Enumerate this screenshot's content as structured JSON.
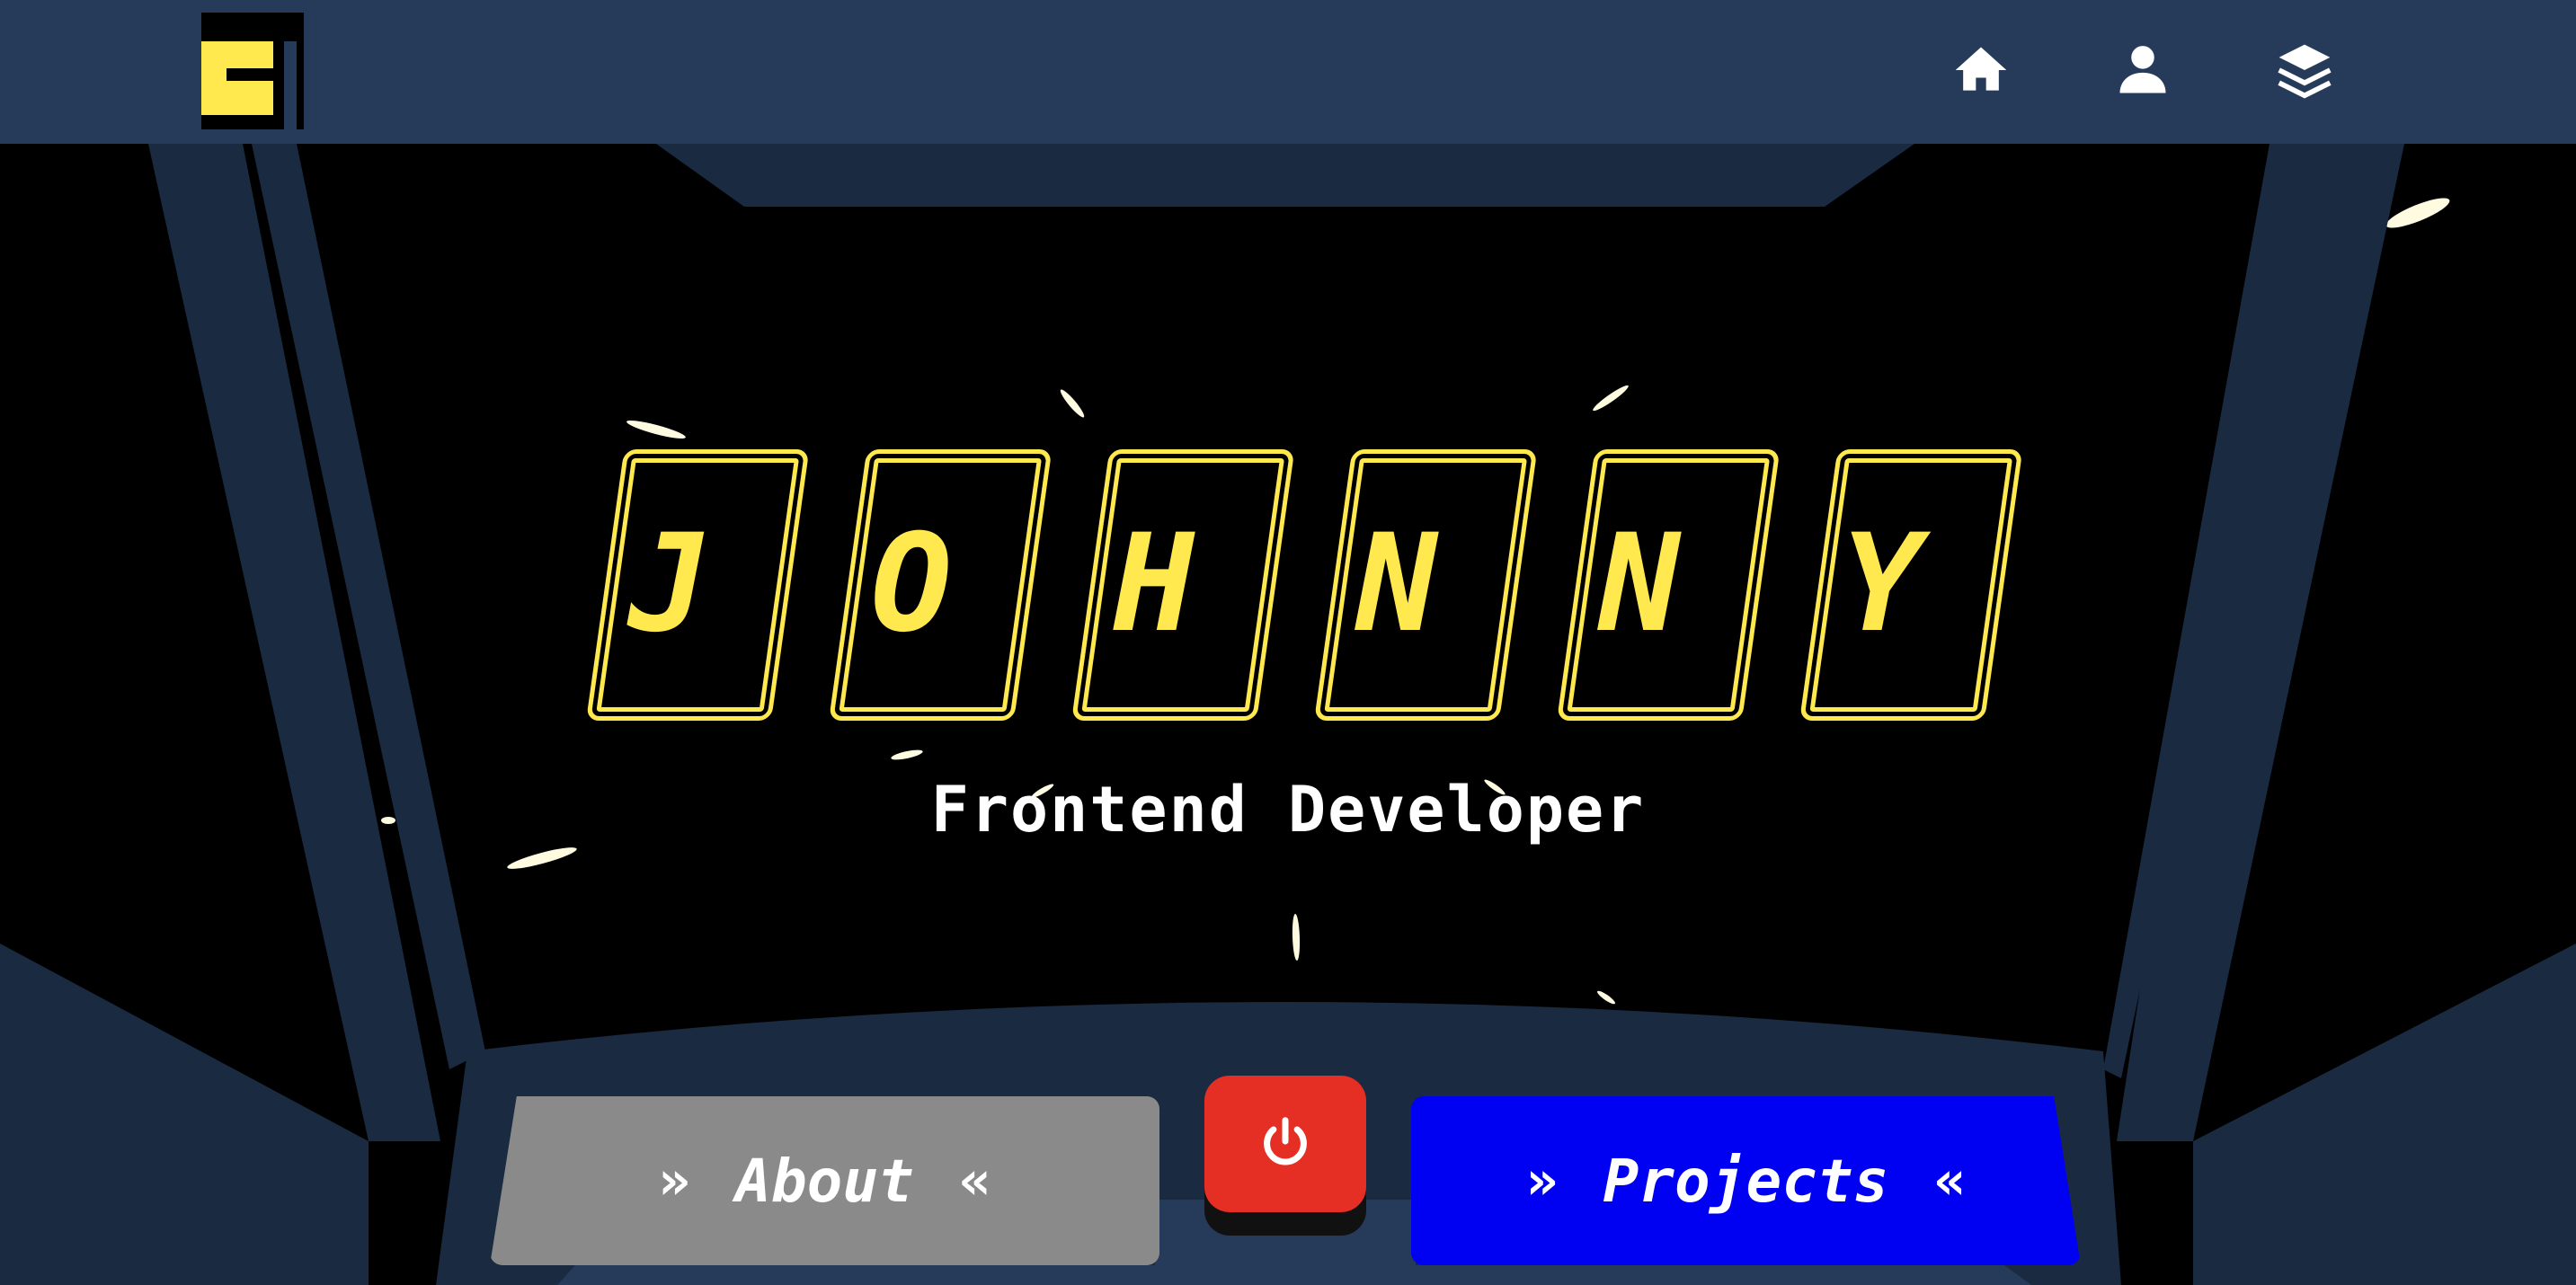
{
  "header": {
    "logo": "EI-logo",
    "nav": [
      {
        "icon": "home-icon"
      },
      {
        "icon": "user-icon"
      },
      {
        "icon": "layers-icon"
      }
    ]
  },
  "hero": {
    "name_letters": [
      "J",
      "O",
      "H",
      "N",
      "N",
      "Y"
    ],
    "subtitle": "Frontend Developer"
  },
  "controls": {
    "about_label": "About",
    "projects_label": "Projects",
    "chevron_left": "»",
    "chevron_right": "«",
    "power_icon": "power-icon"
  },
  "colors": {
    "topbar": "#263b5a",
    "accent_yellow": "#ffe94f",
    "about_button": "#8a8a8a",
    "projects_button": "#0000f2",
    "power_button": "#e52e24"
  }
}
